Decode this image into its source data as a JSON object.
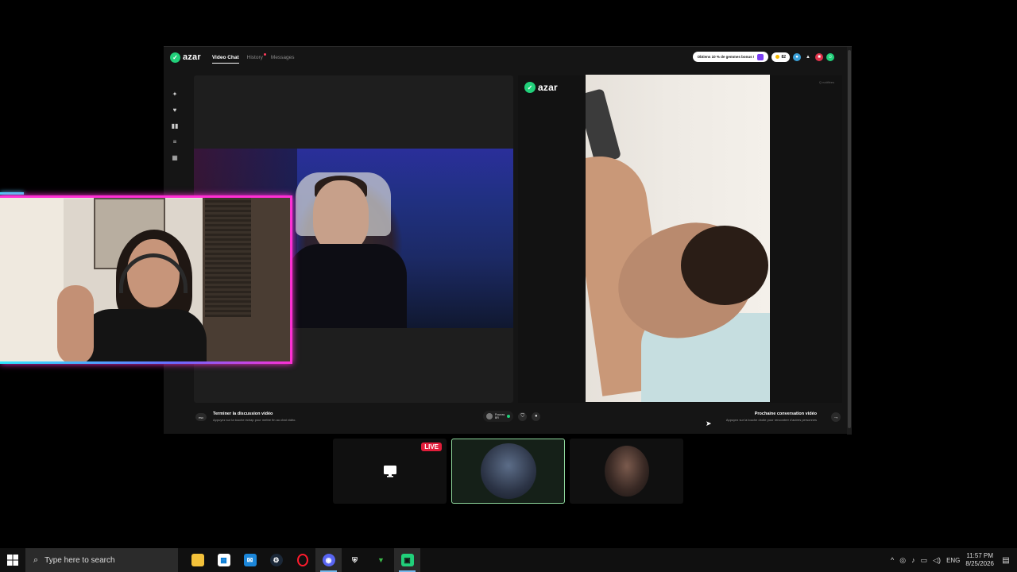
{
  "app": {
    "logo_text": "azar",
    "nav": [
      {
        "label": "Video Chat",
        "active": true
      },
      {
        "label": "History",
        "active": false
      },
      {
        "label": "Messages",
        "active": false
      }
    ],
    "promo_text": "Obtiens 10 % de gemmes bonus !",
    "gems_count": "82",
    "right_panel_logo": "azar",
    "right_panel_corner_text": "Q notifiées",
    "sidebar_icons": [
      "wand-icon",
      "heart-icon",
      "pause-icon",
      "list-icon",
      "grid-icon"
    ]
  },
  "bottom_bar": {
    "esc_label": "esc",
    "end_title": "Terminer la discussion vidéo",
    "end_subtitle": "Appuyez sur la touche échap pour mettre fin au chat vidéo.",
    "country_line1": "Pourras",
    "country_line2": "BR",
    "next_title": "Prochaine conversation vidéo",
    "next_subtitle": "Appuyez sur la touche droite pour rencontrer d'autres personnes",
    "next_arrow": "→"
  },
  "switcher": {
    "live_label": "LIVE",
    "selected_index": 1
  },
  "taskbar": {
    "search_placeholder": "Type here to search",
    "apps": [
      "file-explorer",
      "store",
      "mail",
      "steam",
      "opera",
      "discord",
      "security",
      "vim",
      "azar"
    ],
    "language": "ENG",
    "time": "11:57 PM",
    "date": "8/25/2026"
  },
  "colors": {
    "accent_green": "#21d07a",
    "live_red": "#e21d3a",
    "webcam_border_pink": "#ff2fd4",
    "webcam_border_cyan": "#2ee7ff",
    "selected_card_border": "#8fd99d"
  }
}
